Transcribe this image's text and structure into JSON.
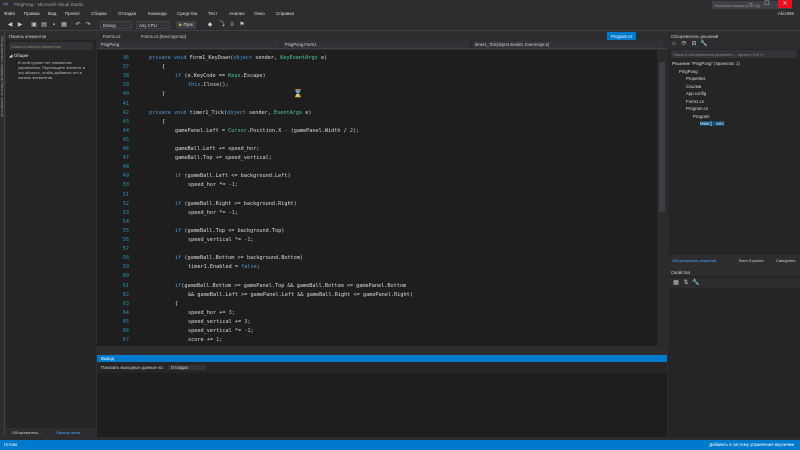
{
  "window": {
    "title": "PingPong - Microsoft Visual Studio",
    "search_placeholder": "Быстрый запуск (Ctrl+Q)",
    "user": "Aki1986"
  },
  "menu": [
    "Файл",
    "Правка",
    "Вид",
    "Проект",
    "Сборка",
    "Отладка",
    "Команда",
    "Средства",
    "Тест",
    "Анализ",
    "Окно",
    "Справка"
  ],
  "toolbar": {
    "config": "Debug",
    "platform": "Any CPU",
    "run_label": "Пуск"
  },
  "toolbox": {
    "strip_label": "Обозреватель серверов   Панель элементов",
    "title": "Панель элементов",
    "search_placeholder": "Поиск в панели элементов",
    "group": "Общие",
    "message": "В этой группе нет элементов управления. Перетащите элемент в эту область, чтобы добавить его в панель элементов.",
    "bottom_tabs": [
      "Обозреватель...",
      "Панель элем..."
    ]
  },
  "editor": {
    "tabs": [
      "Form1.cs",
      "Form1.cs [Конструктор]"
    ],
    "right_tab": "Program.cs",
    "nav": [
      "PingPong",
      "PingPong.Form1",
      "timer1_Tick(object sender, EventArgs e)"
    ],
    "lines": [
      {
        "n": "36",
        "code": [
          [
            "kw",
            "private "
          ],
          [
            "kw",
            "void "
          ],
          [
            "",
            "Form1_KeyDown("
          ],
          [
            "kw",
            "object "
          ],
          [
            "",
            "sender, "
          ],
          [
            "ty",
            "KeyEventArgs "
          ],
          [
            "",
            "e)"
          ]
        ]
      },
      {
        "n": "37",
        "code": [
          [
            "",
            "{"
          ]
        ],
        "indent": 1
      },
      {
        "n": "38",
        "code": [
          [
            "kw",
            "if "
          ],
          [
            "",
            "(e.KeyCode == "
          ],
          [
            "ty",
            "Keys"
          ],
          [
            "",
            ".Escape)"
          ]
        ],
        "indent": 2
      },
      {
        "n": "39",
        "code": [
          [
            "kw",
            "this"
          ],
          [
            "",
            ".Close();"
          ]
        ],
        "indent": 3
      },
      {
        "n": "40",
        "code": [
          [
            "",
            "}"
          ]
        ],
        "indent": 1
      },
      {
        "n": "41",
        "code": []
      },
      {
        "n": "42",
        "code": [
          [
            "kw",
            "private "
          ],
          [
            "kw",
            "void "
          ],
          [
            "",
            "timer1_Tick("
          ],
          [
            "kw",
            "object "
          ],
          [
            "",
            "sender, "
          ],
          [
            "ty",
            "EventArgs "
          ],
          [
            "",
            "e)"
          ]
        ]
      },
      {
        "n": "43",
        "code": [
          [
            "",
            "{"
          ]
        ],
        "indent": 1
      },
      {
        "n": "44",
        "code": [
          [
            "",
            "gamePanel.Left = "
          ],
          [
            "ty",
            "Cursor"
          ],
          [
            "",
            ".Position.X - (gamePanel.Width / "
          ],
          [
            "nm",
            "2"
          ],
          [
            "",
            ");"
          ]
        ],
        "indent": 2
      },
      {
        "n": "45",
        "code": []
      },
      {
        "n": "46",
        "code": [
          [
            "",
            "gameBall.Left += speed_hor;"
          ]
        ],
        "indent": 2
      },
      {
        "n": "47",
        "code": [
          [
            "",
            "gameBall.Top += speed_vertical;"
          ]
        ],
        "indent": 2
      },
      {
        "n": "48",
        "code": []
      },
      {
        "n": "49",
        "code": [
          [
            "kw",
            "if "
          ],
          [
            "",
            "(gameBall.Left <= background.Left)"
          ]
        ],
        "indent": 2
      },
      {
        "n": "50",
        "code": [
          [
            "",
            "speed_hor *= -"
          ],
          [
            "nm",
            "1"
          ],
          [
            "",
            ";"
          ]
        ],
        "indent": 3
      },
      {
        "n": "51",
        "code": []
      },
      {
        "n": "52",
        "code": [
          [
            "kw",
            "if "
          ],
          [
            "",
            "(gameBall.Right >= background.Right)"
          ]
        ],
        "indent": 2
      },
      {
        "n": "53",
        "code": [
          [
            "",
            "speed_hor *= -"
          ],
          [
            "nm",
            "1"
          ],
          [
            "",
            ";"
          ]
        ],
        "indent": 3
      },
      {
        "n": "54",
        "code": []
      },
      {
        "n": "55",
        "code": [
          [
            "kw",
            "if "
          ],
          [
            "",
            "(gameBall.Top <= background.Top)"
          ]
        ],
        "indent": 2
      },
      {
        "n": "56",
        "code": [
          [
            "",
            "speed_vertical *= -"
          ],
          [
            "nm",
            "1"
          ],
          [
            "",
            ";"
          ]
        ],
        "indent": 3
      },
      {
        "n": "57",
        "code": []
      },
      {
        "n": "58",
        "code": [
          [
            "kw",
            "if "
          ],
          [
            "",
            "(gameBall.Bottom >= background.Bottom)"
          ]
        ],
        "indent": 2
      },
      {
        "n": "59",
        "code": [
          [
            "",
            "timer1.Enabled = "
          ],
          [
            "kw",
            "false"
          ],
          [
            "",
            ";"
          ]
        ],
        "indent": 3
      },
      {
        "n": "60",
        "code": []
      },
      {
        "n": "61",
        "code": [
          [
            "kw",
            "if"
          ],
          [
            "",
            "(gameBall.Bottom >= gamePanel.Top && gameBall.Bottom <= gamePanel.Bottom"
          ]
        ],
        "indent": 2
      },
      {
        "n": "62",
        "code": [
          [
            "",
            "&& gameBall.Left >= gamePanel.Left && gameBall.Right <= gamePanel.Right)"
          ]
        ],
        "indent": 3
      },
      {
        "n": "63",
        "code": [
          [
            "",
            "{"
          ]
        ],
        "indent": 2
      },
      {
        "n": "64",
        "code": [
          [
            "",
            "speed_hor += "
          ],
          [
            "nm",
            "3"
          ],
          [
            "",
            ";"
          ]
        ],
        "indent": 3
      },
      {
        "n": "65",
        "code": [
          [
            "",
            "speed_vertical += "
          ],
          [
            "nm",
            "3"
          ],
          [
            "",
            ";"
          ]
        ],
        "indent": 3
      },
      {
        "n": "66",
        "code": [
          [
            "",
            "speed_vertical *= -"
          ],
          [
            "nm",
            "1"
          ],
          [
            "",
            ";"
          ]
        ],
        "indent": 3
      },
      {
        "n": "67",
        "code": [
          [
            "",
            "score += "
          ],
          [
            "nm",
            "1"
          ],
          [
            "",
            ";"
          ]
        ],
        "indent": 3
      }
    ]
  },
  "output": {
    "title": "Вывод",
    "source_label": "Показать выходные данные из:",
    "source_value": "Отладка"
  },
  "solution": {
    "title": "Обозреватель решений",
    "search_placeholder": "Поиск в обозреватель решений — проект (Ctrl+;)",
    "items": [
      {
        "label": "Решение \"PingPong\" (проектов: 1)",
        "indent": 0
      },
      {
        "label": "PingPong",
        "indent": 1
      },
      {
        "label": "Properties",
        "indent": 2
      },
      {
        "label": "Ссылки",
        "indent": 2
      },
      {
        "label": "App.config",
        "indent": 2
      },
      {
        "label": "Form1.cs",
        "indent": 2
      },
      {
        "label": "Program.cs",
        "indent": 2
      },
      {
        "label": "Program",
        "indent": 3
      },
      {
        "label": "Main() : void",
        "indent": 4,
        "selected": true
      }
    ],
    "tabs": [
      "Обозреватель решений",
      "Team Explorer",
      "Categories"
    ]
  },
  "properties": {
    "title": "Свойства"
  },
  "status": {
    "left": "Готово",
    "right": "Добавить в систему управления версиями"
  }
}
